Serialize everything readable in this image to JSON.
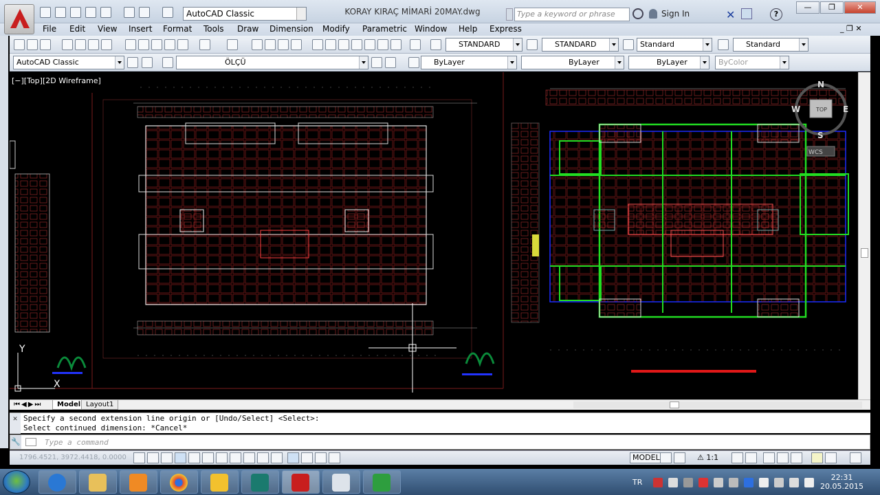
{
  "app": {
    "document_title": "KORAY KIRAÇ MİMARİ 20MAY.dwg",
    "workspace": "AutoCAD Classic",
    "search_placeholder": "Type a keyword or phrase",
    "sign_in": "Sign In",
    "help": "?"
  },
  "menubar": {
    "items": [
      "File",
      "Edit",
      "View",
      "Insert",
      "Format",
      "Tools",
      "Draw",
      "Dimension",
      "Modify",
      "Parametric",
      "Window",
      "Help",
      "Express"
    ]
  },
  "styles_toolbar": {
    "text_style": "STANDARD",
    "dim_style": "STANDARD",
    "table_style": "Standard",
    "mleader_style": "Standard"
  },
  "layers_toolbar": {
    "workspace": "AutoCAD Classic",
    "current_layer": "ÖLÇÜ",
    "color": "ByLayer",
    "linetype": "ByLayer",
    "lineweight": "ByLayer",
    "plotstyle": "ByColor"
  },
  "viewport": {
    "label": "[−][Top][2D Wireframe]",
    "viewcube": {
      "top": "TOP",
      "n": "N",
      "s": "S",
      "e": "E",
      "w": "W",
      "wcs": "WCS"
    },
    "ucs": {
      "x": "X",
      "y": "Y"
    }
  },
  "tabs": {
    "model": "Model",
    "layout": "Layout1"
  },
  "command": {
    "line1": "Specify a second extension line origin or [Undo/Select] <Select>:",
    "line2": "Select continued dimension: *Cancel*",
    "placeholder": "Type a command"
  },
  "status": {
    "coords": "1796.4521, 3972.4418, 0.0000",
    "model": "MODEL",
    "scale": "1:1"
  },
  "tray": {
    "lang": "TR",
    "time": "22:31",
    "date": "20.05.2015"
  },
  "colors": {
    "background": "#000000",
    "walls": "#ffffff",
    "dimensions": "#c83232",
    "structure": "#22dd22",
    "columns": "#1a2cff"
  }
}
